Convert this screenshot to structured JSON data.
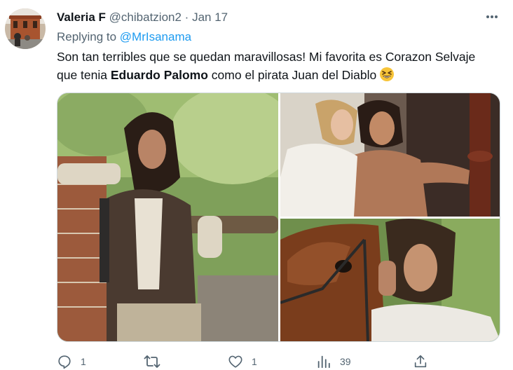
{
  "tweet": {
    "author_name": "Valeria F",
    "handle": "@chibatzion2",
    "separator": "·",
    "date": "Jan 17",
    "replying_prefix": "Replying to ",
    "replying_to": "@MrIsanama",
    "text_part1": "Son tan terribles que se quedan maravillosas! Mi favorita es Corazon Selvaje que tenia ",
    "text_bold": "Eduardo Palomo",
    "text_part2": " como el pirata Juan del Diablo",
    "emoji": "grinning-squinting-face-emoji"
  },
  "actions": {
    "reply_count": "1",
    "retweet_count": "",
    "like_count": "1",
    "views_count": "39"
  },
  "icons": {
    "more": "more-icon",
    "reply": "reply-icon",
    "retweet": "retweet-icon",
    "like": "heart-icon",
    "views": "views-icon",
    "share": "share-icon"
  },
  "colors": {
    "text": "#0f1419",
    "secondary": "#536471",
    "link": "#1d9bf0",
    "border": "#cfd9de"
  }
}
